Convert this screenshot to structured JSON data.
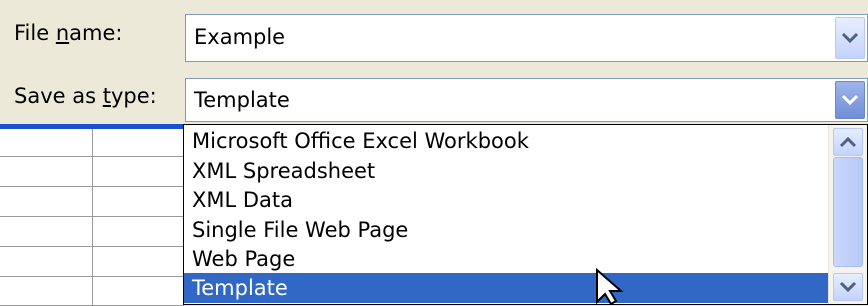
{
  "dialog": {
    "file_name_label_prefix": "File ",
    "file_name_label_key": "n",
    "file_name_label_rest": "ame:",
    "file_name_value": "Example",
    "save_type_label_prefix": "Save as ",
    "save_type_label_key": "t",
    "save_type_label_rest": "ype:",
    "save_type_value": "Template"
  },
  "type_list": {
    "items": [
      "Microsoft Office Excel Workbook",
      "XML Spreadsheet",
      "XML Data",
      "Single File Web Page",
      "Web Page",
      "Template"
    ],
    "selected_index": 5
  },
  "icons": {
    "dropdown": "chevron-down-icon",
    "scroll_up": "chevron-up-icon",
    "scroll_down": "chevron-down-icon",
    "cursor": "mouse-pointer-icon"
  },
  "colors": {
    "selection": "#3168c5",
    "accent_bar": "#1b4fd3",
    "dialog_bg": "#ece9d8"
  }
}
